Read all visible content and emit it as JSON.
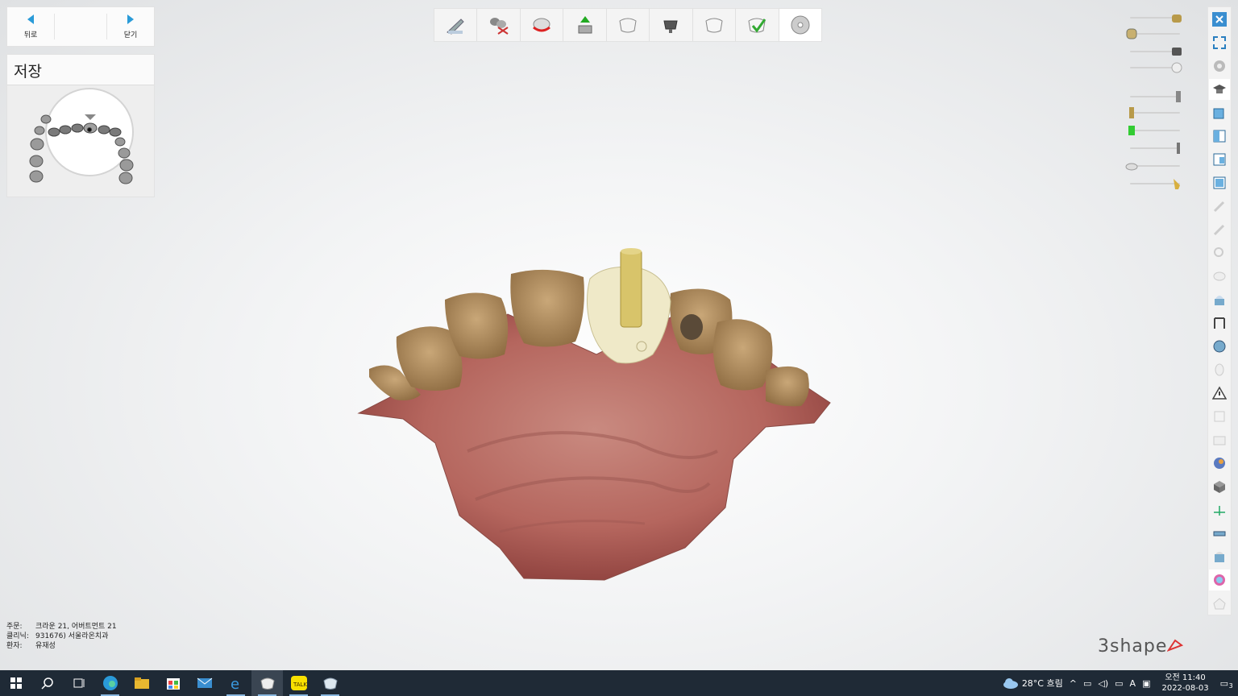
{
  "nav": {
    "back_label": "뒤로",
    "close_label": "닫기"
  },
  "save_panel": {
    "title": "저장"
  },
  "toolbar": {
    "steps": [
      {
        "icon": "scan-prep-icon"
      },
      {
        "icon": "cut-trim-icon"
      },
      {
        "icon": "margin-icon"
      },
      {
        "icon": "insertion-direction-icon"
      },
      {
        "icon": "crown-anatomy-icon"
      },
      {
        "icon": "abutment-icon"
      },
      {
        "icon": "crown-design-icon"
      },
      {
        "icon": "crown-check-icon"
      },
      {
        "icon": "save-disc-icon"
      }
    ]
  },
  "info": {
    "order_key": "주문:",
    "order_val": "크라운 21, 어버트먼트 21",
    "clinic_key": "클리닉:",
    "clinic_val": "931676) 서울라온치과",
    "patient_key": "환자:",
    "patient_val": "유재성"
  },
  "logo": "3shape",
  "tray": {
    "weather": "28°C  흐림",
    "ime": "A",
    "time": "오전 11:40",
    "date": "2022-08-03",
    "notif": "3"
  },
  "colors": {
    "accent": "#2a9bd8",
    "taskbar": "#1f2a36",
    "gum": "#b86a62",
    "abutment": "#d8c46a"
  }
}
